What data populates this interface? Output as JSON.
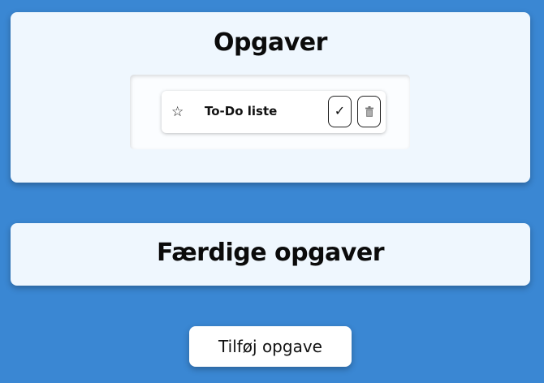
{
  "theme": {
    "background": "#3a87d3",
    "card_background": "#eff7fe",
    "item_background": "#ffffff",
    "text_color": "#111111"
  },
  "tasks_section": {
    "title": "Opgaver",
    "items": [
      {
        "label": "To-Do liste",
        "star_icon": "star-outline-icon",
        "star_glyph": "☆",
        "complete_icon": "checkmark-icon",
        "complete_glyph": "✓",
        "delete_icon": "trash-icon"
      }
    ]
  },
  "done_section": {
    "title": "Færdige opgaver",
    "items": []
  },
  "add_button_label": "Tilføj opgave"
}
